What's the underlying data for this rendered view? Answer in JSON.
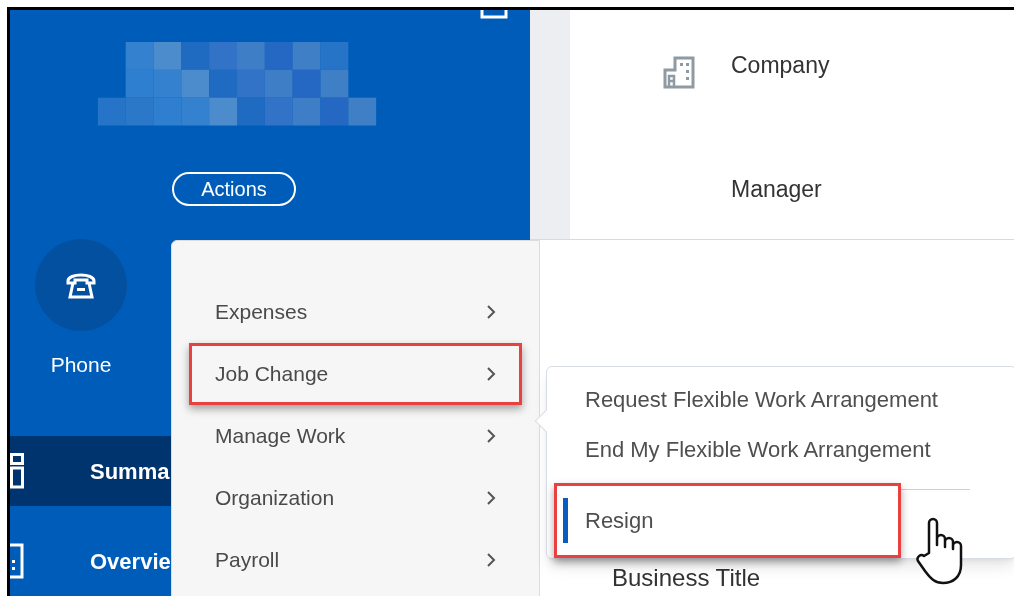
{
  "profile": {
    "actions_button": "Actions"
  },
  "quick_actions": [
    {
      "label": "Phone"
    }
  ],
  "nav": [
    {
      "label": "Summa",
      "selected": true
    },
    {
      "label": "Overvie",
      "selected": false
    }
  ],
  "details": [
    {
      "label": "Company",
      "kind": "building"
    },
    {
      "label": "Manager",
      "kind": "plain"
    }
  ],
  "actions_menu": {
    "items": [
      {
        "label": "Expenses",
        "highlighted": false
      },
      {
        "label": "Job Change",
        "highlighted": true
      },
      {
        "label": "Manage Work",
        "highlighted": false
      },
      {
        "label": "Organization",
        "highlighted": false
      },
      {
        "label": "Payroll",
        "highlighted": false
      }
    ]
  },
  "submenu": {
    "groups": [
      {
        "items": [
          {
            "label": "Request Flexible Work Arrangement",
            "selected": false,
            "highlighted": false
          },
          {
            "label": "End My Flexible Work Arrangement",
            "selected": false,
            "highlighted": false
          }
        ]
      },
      {
        "items": [
          {
            "label": "Resign",
            "selected": true,
            "highlighted": true
          }
        ]
      }
    ]
  },
  "section_heading": "Business Title"
}
